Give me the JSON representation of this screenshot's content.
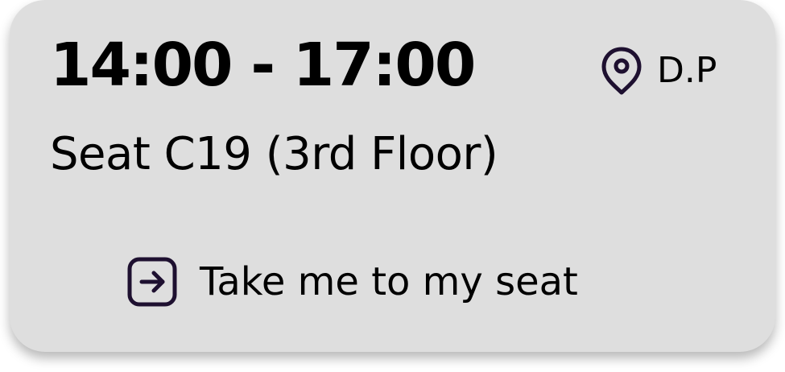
{
  "booking": {
    "time_range": "14:00 - 17:00",
    "seat": "Seat C19 (3rd Floor)",
    "location_label": "D.P",
    "location_icon": "map-pin-icon",
    "action_label": "Take me to my seat",
    "action_icon": "arrow-right-square-icon"
  },
  "colors": {
    "card_background": "#dedede",
    "icon_color": "#1e1030",
    "text": "#000000"
  }
}
